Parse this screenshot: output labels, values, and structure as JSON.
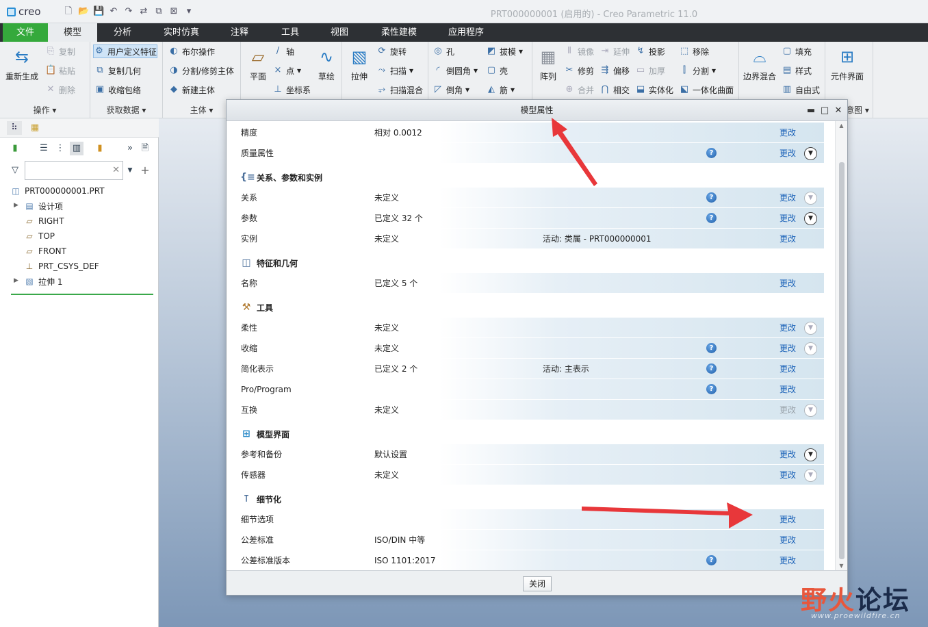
{
  "app": {
    "logo": "creo",
    "window_title": "PRT000000001 (启用的) - Creo Parametric 11.0"
  },
  "tabs": [
    "文件",
    "模型",
    "分析",
    "实时仿真",
    "注释",
    "工具",
    "视图",
    "柔性建模",
    "应用程序"
  ],
  "ribbon": {
    "operations": {
      "regen": "重新生成",
      "copy": "复制",
      "paste": "粘贴",
      "delete": "删除",
      "label": "操作"
    },
    "getdata": {
      "udf": "用户定义特征",
      "copygeom": "复制几何",
      "shrinkwrap": "收缩包络",
      "label": "获取数据"
    },
    "body": {
      "boolean": "布尔操作",
      "split": "分割/修剪主体",
      "newbody": "新建主体",
      "label": "主体"
    },
    "datum": {
      "plane": "平面",
      "axis": "轴",
      "point": "点",
      "csys": "坐标系",
      "sketch": "草绘"
    },
    "shapes": {
      "extrude": "拉伸",
      "revolve": "旋转",
      "sweep": "扫描",
      "blend": "扫描混合"
    },
    "engineering": {
      "hole": "孔",
      "round": "倒圆角",
      "chamfer": "倒角",
      "draft": "拔模",
      "shell": "壳",
      "rib": "筋"
    },
    "editing": {
      "pattern": "阵列",
      "mirror": "镜像",
      "extend": "延伸",
      "project": "投影",
      "trim": "修剪",
      "offset": "偏移",
      "thicken": "加厚",
      "merge": "合并",
      "intersect": "相交",
      "solidify": "实体化",
      "remove": "移除",
      "split": "分割",
      "quilt": "一体化曲面"
    },
    "surfaces": {
      "boundary": "边界混合",
      "fill": "填充",
      "style": "样式",
      "freestyle": "自由式"
    },
    "model_intent": {
      "component_interface": "元件界面",
      "label_tail": "意图"
    }
  },
  "left_panel": {
    "search_placeholder": "",
    "tree": [
      "PRT000000001.PRT",
      "设计项",
      "RIGHT",
      "TOP",
      "FRONT",
      "PRT_CSYS_DEF",
      "拉伸 1"
    ]
  },
  "dialog": {
    "title": "模型属性",
    "close_label": "关闭",
    "change_label": "更改",
    "top_rows": [
      {
        "name": "精度",
        "value": "相对 0.0012"
      },
      {
        "name": "质量属性",
        "value": ""
      }
    ],
    "sections": [
      {
        "title": "关系、参数和实例",
        "rows": [
          {
            "name": "关系",
            "value": "未定义",
            "extra": ""
          },
          {
            "name": "参数",
            "value": "已定义 32 个",
            "extra": ""
          },
          {
            "name": "实例",
            "value": "未定义",
            "extra": "活动: 类属 - PRT000000001"
          }
        ]
      },
      {
        "title": "特征和几何",
        "rows": [
          {
            "name": "名称",
            "value": "已定义 5 个",
            "extra": ""
          }
        ]
      },
      {
        "title": "工具",
        "rows": [
          {
            "name": "柔性",
            "value": "未定义",
            "extra": ""
          },
          {
            "name": "收缩",
            "value": "未定义",
            "extra": ""
          },
          {
            "name": "简化表示",
            "value": "已定义 2 个",
            "extra": "活动: 主表示"
          },
          {
            "name": "Pro/Program",
            "value": "",
            "extra": ""
          },
          {
            "name": "互换",
            "value": "未定义",
            "extra": ""
          }
        ]
      },
      {
        "title": "模型界面",
        "rows": [
          {
            "name": "参考和备份",
            "value": "默认设置",
            "extra": ""
          },
          {
            "name": "传感器",
            "value": "未定义",
            "extra": ""
          }
        ]
      },
      {
        "title": "细节化",
        "rows": [
          {
            "name": "细节选项",
            "value": "",
            "extra": ""
          },
          {
            "name": "公差标准",
            "value": "ISO/DIN 中等",
            "extra": ""
          },
          {
            "name": "公差标准版本",
            "value": "ISO 1101:2017",
            "extra": ""
          }
        ]
      }
    ]
  },
  "watermark": {
    "text1": "野火",
    "text2": "论坛",
    "url": "www.proewildfire.cn"
  },
  "colors": {
    "file_tab": "#35a93c",
    "link": "#1b62b8",
    "arrow": "#e8373a"
  }
}
